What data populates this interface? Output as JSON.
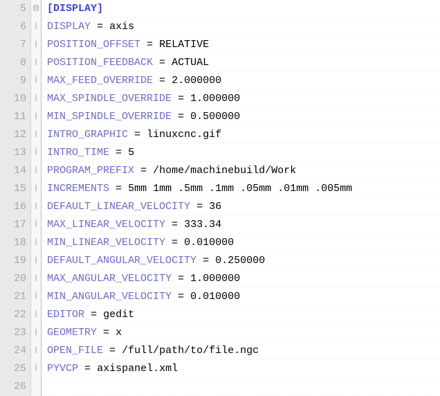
{
  "section_header": "[DISPLAY]",
  "lines": [
    {
      "num": 5,
      "type": "section",
      "key": "[DISPLAY]",
      "value": ""
    },
    {
      "num": 6,
      "type": "kv",
      "key": "DISPLAY",
      "value": "axis"
    },
    {
      "num": 7,
      "type": "kv",
      "key": "POSITION_OFFSET",
      "value": "RELATIVE"
    },
    {
      "num": 8,
      "type": "kv",
      "key": "POSITION_FEEDBACK",
      "value": "ACTUAL"
    },
    {
      "num": 9,
      "type": "kv",
      "key": "MAX_FEED_OVERRIDE",
      "value": "2.000000"
    },
    {
      "num": 10,
      "type": "kv",
      "key": "MAX_SPINDLE_OVERRIDE",
      "value": "1.000000"
    },
    {
      "num": 11,
      "type": "kv",
      "key": "MIN_SPINDLE_OVERRIDE",
      "value": "0.500000"
    },
    {
      "num": 12,
      "type": "kv",
      "key": "INTRO_GRAPHIC",
      "value": "linuxcnc.gif"
    },
    {
      "num": 13,
      "type": "kv",
      "key": "INTRO_TIME",
      "value": "5"
    },
    {
      "num": 14,
      "type": "kv",
      "key": "PROGRAM_PREFIX",
      "value": "/home/machinebuild/Work"
    },
    {
      "num": 15,
      "type": "kv",
      "key": "INCREMENTS",
      "value": "5mm 1mm .5mm .1mm .05mm .01mm .005mm"
    },
    {
      "num": 16,
      "type": "kv",
      "key": "DEFAULT_LINEAR_VELOCITY",
      "value": "36"
    },
    {
      "num": 17,
      "type": "kv",
      "key": "MAX_LINEAR_VELOCITY",
      "value": "333.34"
    },
    {
      "num": 18,
      "type": "kv",
      "key": "MIN_LINEAR_VELOCITY",
      "value": "0.010000"
    },
    {
      "num": 19,
      "type": "kv",
      "key": "DEFAULT_ANGULAR_VELOCITY",
      "value": "0.250000"
    },
    {
      "num": 20,
      "type": "kv",
      "key": "MAX_ANGULAR_VELOCITY",
      "value": "1.000000"
    },
    {
      "num": 21,
      "type": "kv",
      "key": "MIN_ANGULAR_VELOCITY",
      "value": "0.010000"
    },
    {
      "num": 22,
      "type": "kv",
      "key": "EDITOR",
      "value": "gedit"
    },
    {
      "num": 23,
      "type": "kv",
      "key": "GEOMETRY",
      "value": "x"
    },
    {
      "num": 24,
      "type": "kv",
      "key": "OPEN_FILE",
      "value": "/full/path/to/file.ngc"
    },
    {
      "num": 25,
      "type": "kv",
      "key": "PYVCP",
      "value": "axispanel.xml"
    },
    {
      "num": 26,
      "type": "blank",
      "key": "",
      "value": ""
    }
  ],
  "fold_glyph": "⊟"
}
